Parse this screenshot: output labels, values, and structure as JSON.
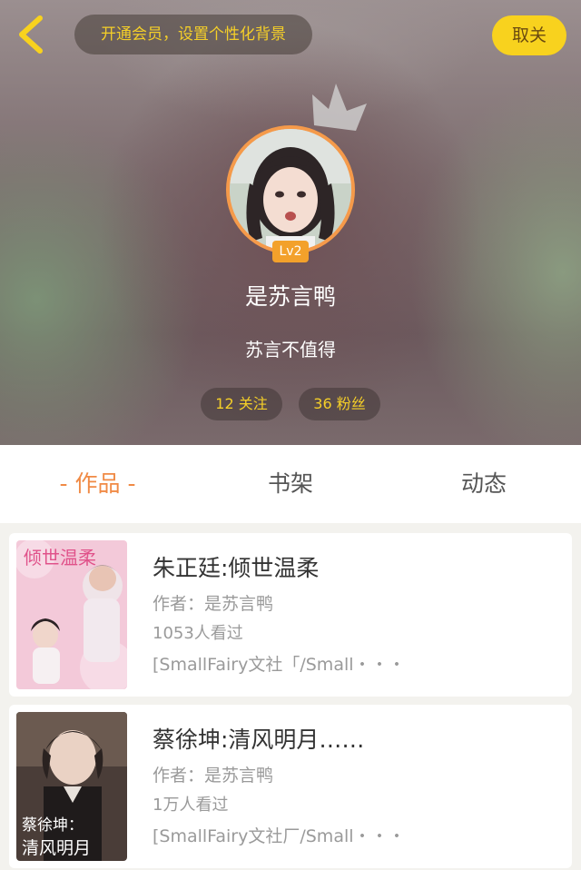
{
  "header": {
    "vip_banner": "开通会员，设置个性化背景",
    "unfollow_label": "取关",
    "level": "Lv2",
    "username": "是苏言鸭",
    "signature": "苏言不值得",
    "follow_stat": "12 关注",
    "fans_stat": "36 粉丝"
  },
  "tabs": {
    "works": "- 作品 -",
    "shelf": "书架",
    "activity": "动态"
  },
  "works": [
    {
      "title": "朱正廷:倾世温柔",
      "author": "作者：是苏言鸭",
      "views": "1053人看过",
      "tags": "[SmallFairy文社「/Small・・・",
      "cover_text": "倾世温柔"
    },
    {
      "title": "蔡徐坤:清风明月……",
      "author": "作者：是苏言鸭",
      "views": "1万人看过",
      "tags": "[SmallFairy文社厂/Small・・・",
      "cover_text_1": "蔡徐坤：",
      "cover_text_2": "清风明月"
    }
  ],
  "colors": {
    "accent_yellow": "#f8d21e",
    "tab_active": "#f08a45",
    "avatar_ring": "#f59a4a",
    "level_badge": "#f3a12b"
  }
}
